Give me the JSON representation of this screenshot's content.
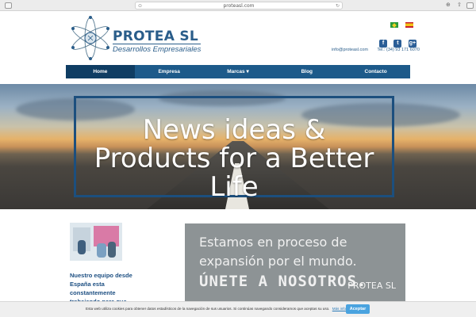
{
  "browser": {
    "url": "proteasl.com"
  },
  "header": {
    "brand": "PROTEA SL",
    "tagline": "Desarrollos Empresariales",
    "email": "info@proteasl.com",
    "phone": "Tel.: (34) 93 171 6070",
    "languages": [
      "Português",
      "Español"
    ],
    "social": [
      "facebook-icon",
      "twitter-icon",
      "google-plus-icon"
    ]
  },
  "nav": {
    "items": [
      {
        "label": "Home"
      },
      {
        "label": "Empresa"
      },
      {
        "label": "Marcas ▾"
      },
      {
        "label": "Blog"
      },
      {
        "label": "Contacto"
      }
    ]
  },
  "hero": {
    "line1": "News ideas &",
    "line2": "Products for a Better Life"
  },
  "content": {
    "team_text": "Nuestro equipo desde España esta constantemente trabajando para que",
    "promo_line1": "Estamos en proceso de",
    "promo_line2": "expansión por el mundo.",
    "promo_line3": "ÚNETE A NOSOTROS.",
    "promo_brand": "PROTEA SL"
  },
  "cookie": {
    "text": "Esta web utiliza cookies para obtener datos estadísticos de la navegación de sus usuarios. Si continúas navegando consideramos que aceptas su uso.",
    "link": "Más información",
    "accept": "Aceptar"
  },
  "colors": {
    "nav": "#1d5a8a",
    "nav_active": "#0f3d63",
    "brand": "#2a5d8a",
    "cookie_button": "#4aa3df"
  }
}
